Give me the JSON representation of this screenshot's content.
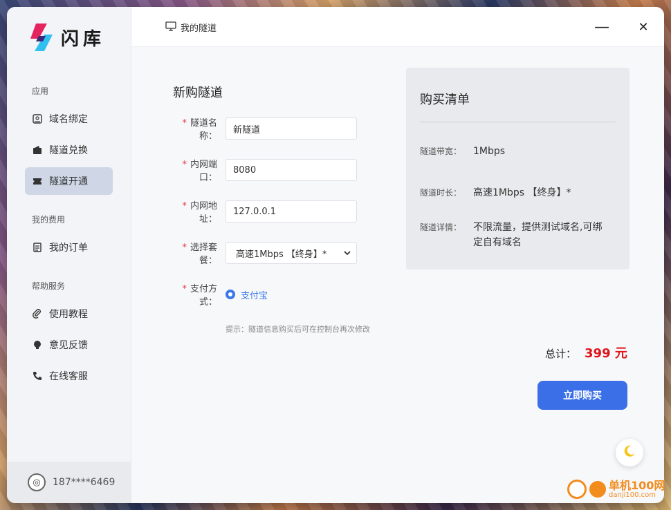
{
  "app": {
    "name": "闪库"
  },
  "sidebar": {
    "sections": [
      {
        "label": "应用"
      },
      {
        "label": "我的费用"
      },
      {
        "label": "帮助服务"
      }
    ],
    "items": [
      {
        "label": "域名绑定",
        "icon": "domain-icon"
      },
      {
        "label": "隧道兑换",
        "icon": "wallet-icon"
      },
      {
        "label": "隧道开通",
        "icon": "ticket-icon",
        "active": true
      },
      {
        "label": "我的订单",
        "icon": "document-icon"
      },
      {
        "label": "使用教程",
        "icon": "paperclip-icon"
      },
      {
        "label": "意见反馈",
        "icon": "bulb-icon"
      },
      {
        "label": "在线客服",
        "icon": "phone-icon"
      }
    ],
    "user": "187****6469"
  },
  "topbar": {
    "title": "我的隧道",
    "minimize": "—",
    "close": "✕"
  },
  "form": {
    "title": "新购隧道",
    "required_mark": "*",
    "fields": [
      {
        "label": "隧道名称：",
        "value": "新隧道"
      },
      {
        "label": "内网端口：",
        "value": "8080"
      },
      {
        "label": "内网地址：",
        "value": "127.0.0.1"
      },
      {
        "label": "选择套餐：",
        "value": "高速1Mbps 【终身】*"
      },
      {
        "label": "支付方式：",
        "value": "支付宝"
      }
    ],
    "hint": "提示：隧道信息购买后可在控制台再次修改"
  },
  "summary": {
    "title": "购买清单",
    "rows": [
      {
        "key": "隧道带宽：",
        "value": "1Mbps"
      },
      {
        "key": "隧道时长：",
        "value": "高速1Mbps 【终身】*"
      },
      {
        "key": "隧道详情：",
        "value": "不限流量，提供测试域名,可绑定自有域名"
      }
    ],
    "total_label": "总计：",
    "total_amount": "399 元",
    "buy_label": "立即购买"
  },
  "watermark": {
    "text": "单机100网",
    "sub": "danji100.com"
  },
  "colors": {
    "accent": "#3b6fe8",
    "price": "#e0141b",
    "required": "#e23b3b"
  }
}
